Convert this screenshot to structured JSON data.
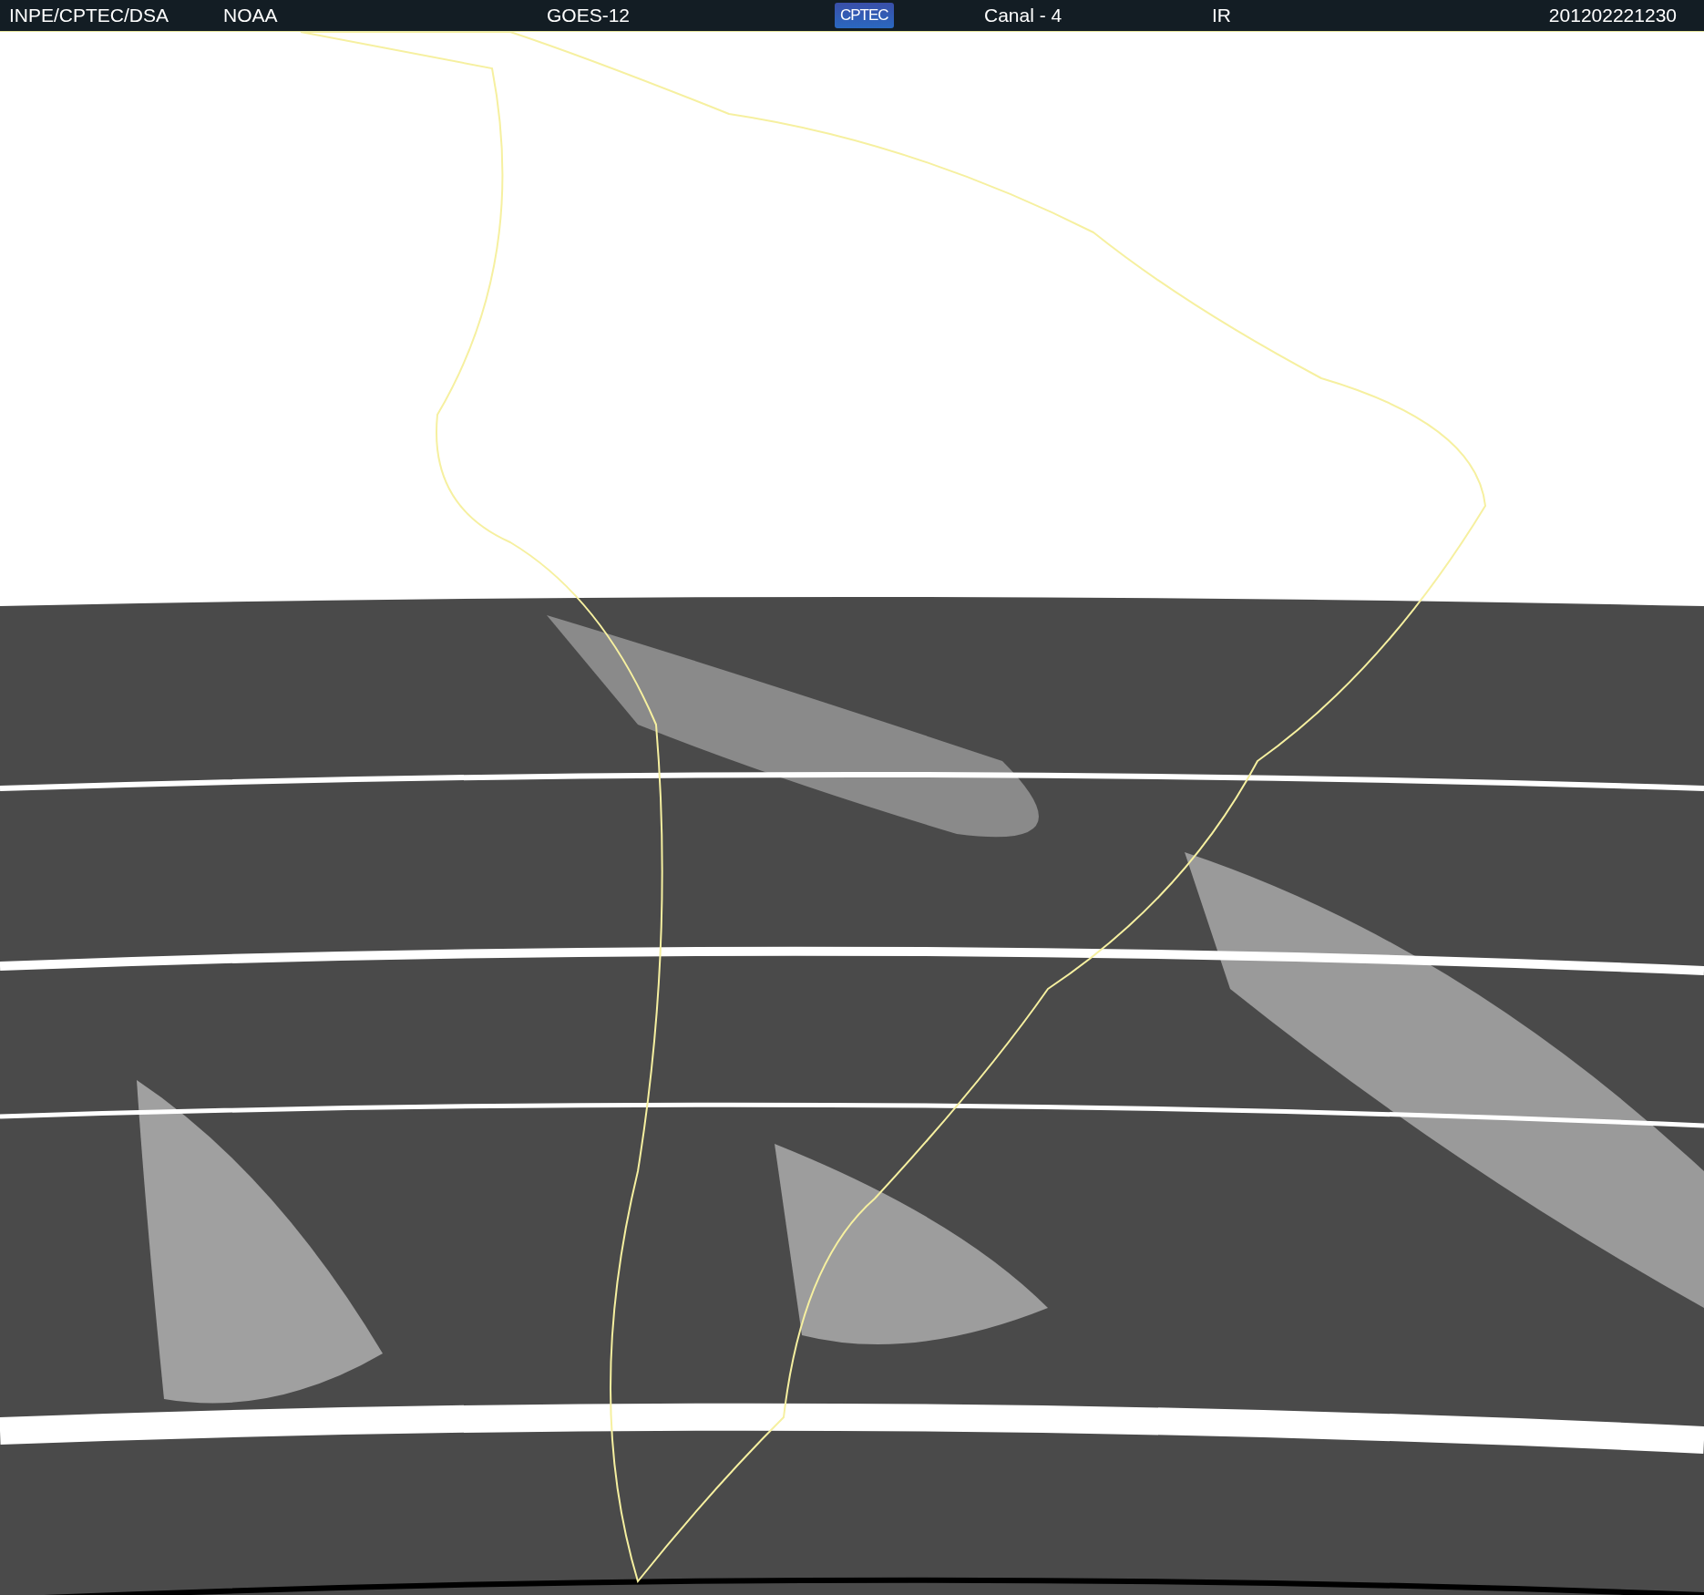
{
  "header": {
    "items": [
      {
        "kind": "text",
        "text": "INPE/CPTEC/DSA"
      },
      {
        "kind": "text",
        "text": "NOAA"
      },
      {
        "kind": "text",
        "text": "GOES-12"
      },
      {
        "kind": "logo",
        "text": "CPTEC"
      },
      {
        "kind": "text",
        "text": "Canal - 4"
      },
      {
        "kind": "text",
        "text": "IR"
      },
      {
        "kind": "text",
        "text": "201202221230"
      }
    ]
  }
}
